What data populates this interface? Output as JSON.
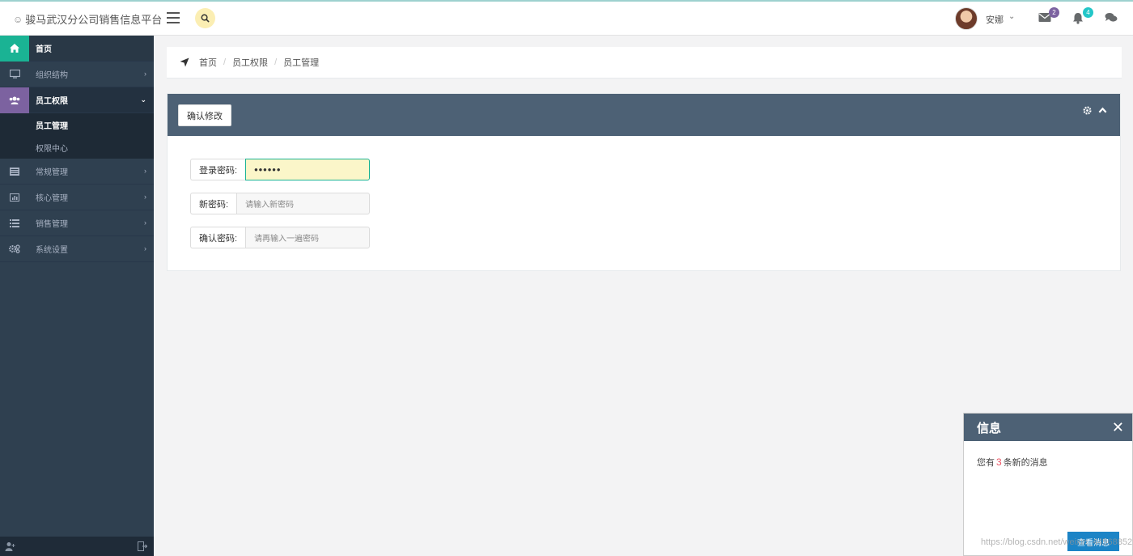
{
  "app": {
    "title": "骏马武汉分公司销售信息平台"
  },
  "header": {
    "user_name": "安娜",
    "mail_count": "2",
    "bell_count": "4",
    "colors": {
      "mail_badge": "#7c62a0",
      "bell_badge": "#23c6c8"
    }
  },
  "sidebar": {
    "items": [
      {
        "label": "首页",
        "icon": "home-icon"
      },
      {
        "label": "组织结构",
        "icon": "monitor-icon"
      },
      {
        "label": "员工权限",
        "icon": "users-icon"
      },
      {
        "label": "常规管理",
        "icon": "list-icon"
      },
      {
        "label": "核心管理",
        "icon": "bar-chart-icon"
      },
      {
        "label": "销售管理",
        "icon": "table-icon"
      },
      {
        "label": "系统设置",
        "icon": "gears-icon"
      }
    ],
    "submenu": [
      {
        "label": "员工管理"
      },
      {
        "label": "权限中心"
      }
    ]
  },
  "breadcrumb": [
    "首页",
    "员工权限",
    "员工管理"
  ],
  "panel": {
    "confirm_label": "确认修改",
    "fields": [
      {
        "label": "登录密码:",
        "value": "••••••"
      },
      {
        "label": "新密码:",
        "placeholder": "请输入新密码"
      },
      {
        "label": "确认密码:",
        "placeholder": "请再输入一遍密码"
      }
    ]
  },
  "notice": {
    "title": "信息",
    "prefix": "您有",
    "count": "3",
    "suffix": "条新的消息",
    "button": "查看消息"
  },
  "watermark": "https://blog.csdn.net/weixin_44568852"
}
